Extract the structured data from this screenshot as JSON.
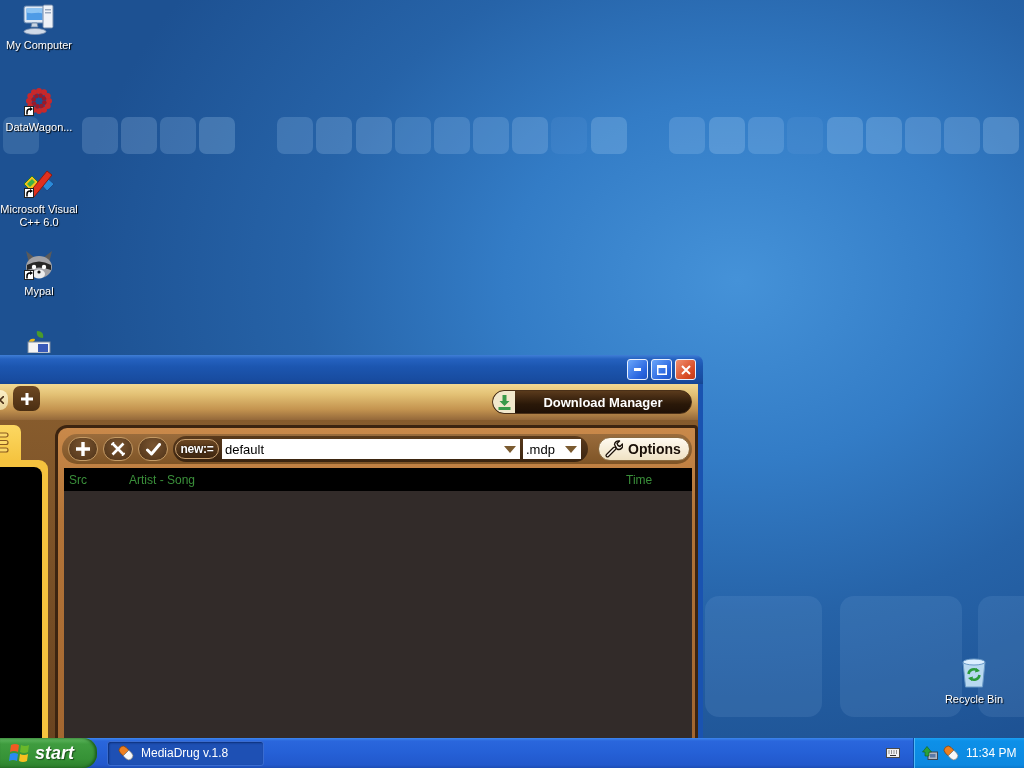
{
  "desktop": {
    "icons": [
      {
        "label": "My Computer",
        "shortcut": false
      },
      {
        "label": "DataWagon...",
        "shortcut": true
      },
      {
        "label": "Microsoft Visual C++ 6.0",
        "shortcut": true
      },
      {
        "label": "Mypal",
        "shortcut": true
      },
      {
        "shortcut": false
      }
    ],
    "recycle_bin": {
      "label": "Recycle Bin"
    }
  },
  "window": {
    "download_manager_button": "Download Manager",
    "toolbar": {
      "new_button": "new:=",
      "playlist_field": {
        "value": "default"
      },
      "extension_field": {
        "value": ".mdp"
      },
      "options_button": "Options"
    },
    "playlist": {
      "columns": [
        "Src",
        "Artist - Song",
        "Time"
      ]
    }
  },
  "taskbar": {
    "start_button": "start",
    "tasks": [
      {
        "label": "MediaDrug v.1.8",
        "selected": true
      }
    ],
    "clock": "11:34 PM"
  }
}
